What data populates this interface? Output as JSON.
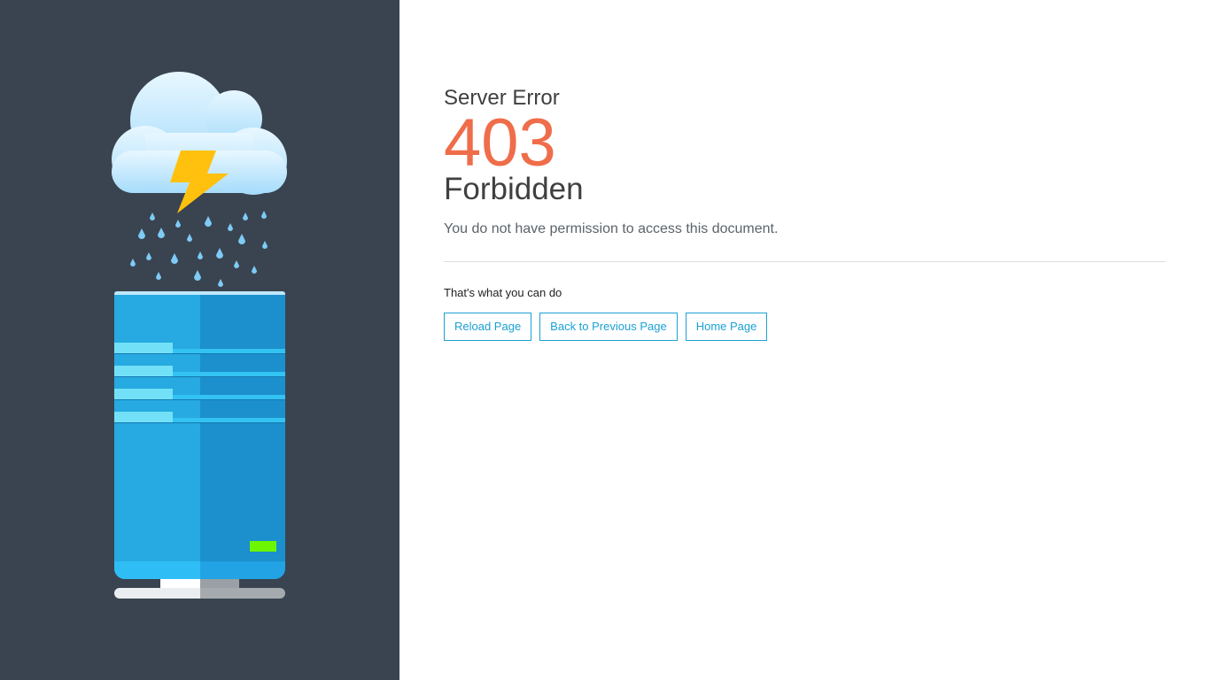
{
  "page": {
    "subtitle": "Server Error",
    "code": "403",
    "status": "Forbidden",
    "message": "You do not have permission to access this document."
  },
  "help": {
    "title": "That's what you can do",
    "buttons": [
      {
        "label": "Reload Page"
      },
      {
        "label": "Back to Previous Page"
      },
      {
        "label": "Home Page"
      }
    ]
  },
  "theme": {
    "left_panel_bg": "#394450",
    "accent": "#1ba1d4",
    "code_color": "#ef6d4a",
    "text_dark": "#404040"
  },
  "illustration": {
    "icon": "server-rain-cloud-lightning"
  }
}
